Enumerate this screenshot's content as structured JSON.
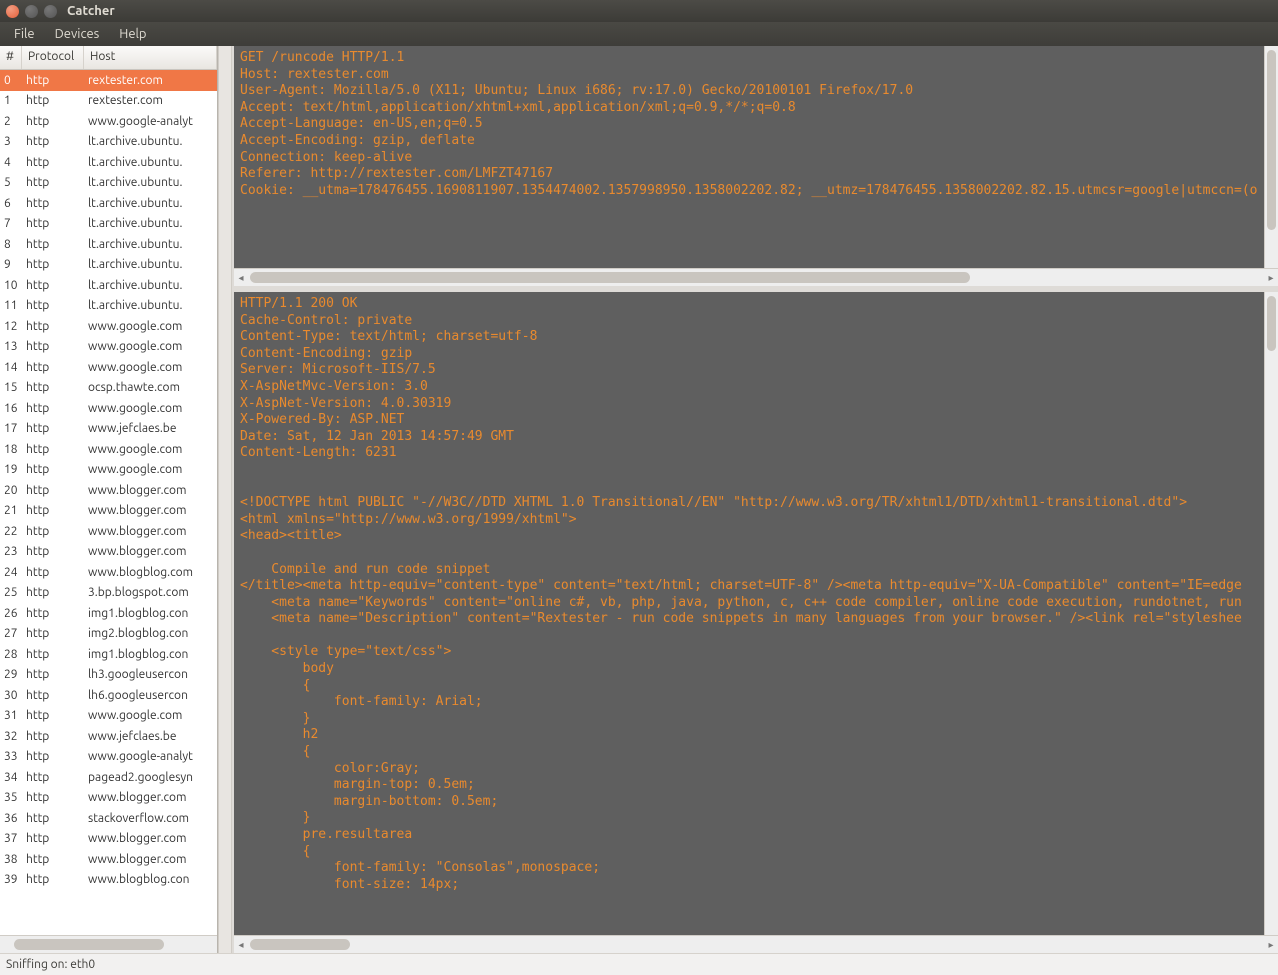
{
  "window": {
    "title": "Catcher"
  },
  "menu": {
    "file": "File",
    "devices": "Devices",
    "help": "Help"
  },
  "table": {
    "headers": {
      "num": "#",
      "protocol": "Protocol",
      "host": "Host"
    },
    "selected_index": 0,
    "rows": [
      {
        "num": "0",
        "protocol": "http",
        "host": "rextester.com"
      },
      {
        "num": "1",
        "protocol": "http",
        "host": "rextester.com"
      },
      {
        "num": "2",
        "protocol": "http",
        "host": "www.google-analyt"
      },
      {
        "num": "3",
        "protocol": "http",
        "host": "lt.archive.ubuntu."
      },
      {
        "num": "4",
        "protocol": "http",
        "host": "lt.archive.ubuntu."
      },
      {
        "num": "5",
        "protocol": "http",
        "host": "lt.archive.ubuntu."
      },
      {
        "num": "6",
        "protocol": "http",
        "host": "lt.archive.ubuntu."
      },
      {
        "num": "7",
        "protocol": "http",
        "host": "lt.archive.ubuntu."
      },
      {
        "num": "8",
        "protocol": "http",
        "host": "lt.archive.ubuntu."
      },
      {
        "num": "9",
        "protocol": "http",
        "host": "lt.archive.ubuntu."
      },
      {
        "num": "10",
        "protocol": "http",
        "host": "lt.archive.ubuntu."
      },
      {
        "num": "11",
        "protocol": "http",
        "host": "lt.archive.ubuntu."
      },
      {
        "num": "12",
        "protocol": "http",
        "host": "www.google.com"
      },
      {
        "num": "13",
        "protocol": "http",
        "host": "www.google.com"
      },
      {
        "num": "14",
        "protocol": "http",
        "host": "www.google.com"
      },
      {
        "num": "15",
        "protocol": "http",
        "host": "ocsp.thawte.com"
      },
      {
        "num": "16",
        "protocol": "http",
        "host": "www.google.com"
      },
      {
        "num": "17",
        "protocol": "http",
        "host": "www.jefclaes.be"
      },
      {
        "num": "18",
        "protocol": "http",
        "host": "www.google.com"
      },
      {
        "num": "19",
        "protocol": "http",
        "host": "www.google.com"
      },
      {
        "num": "20",
        "protocol": "http",
        "host": "www.blogger.com"
      },
      {
        "num": "21",
        "protocol": "http",
        "host": "www.blogger.com"
      },
      {
        "num": "22",
        "protocol": "http",
        "host": "www.blogger.com"
      },
      {
        "num": "23",
        "protocol": "http",
        "host": "www.blogger.com"
      },
      {
        "num": "24",
        "protocol": "http",
        "host": "www.blogblog.com"
      },
      {
        "num": "25",
        "protocol": "http",
        "host": "3.bp.blogspot.com"
      },
      {
        "num": "26",
        "protocol": "http",
        "host": "img1.blogblog.con"
      },
      {
        "num": "27",
        "protocol": "http",
        "host": "img2.blogblog.con"
      },
      {
        "num": "28",
        "protocol": "http",
        "host": "img1.blogblog.con"
      },
      {
        "num": "29",
        "protocol": "http",
        "host": "lh3.googleusercon"
      },
      {
        "num": "30",
        "protocol": "http",
        "host": "lh6.googleusercon"
      },
      {
        "num": "31",
        "protocol": "http",
        "host": "www.google.com"
      },
      {
        "num": "32",
        "protocol": "http",
        "host": "www.jefclaes.be"
      },
      {
        "num": "33",
        "protocol": "http",
        "host": "www.google-analyt"
      },
      {
        "num": "34",
        "protocol": "http",
        "host": "pagead2.googlesyn"
      },
      {
        "num": "35",
        "protocol": "http",
        "host": "www.blogger.com"
      },
      {
        "num": "36",
        "protocol": "http",
        "host": "stackoverflow.com"
      },
      {
        "num": "37",
        "protocol": "http",
        "host": "www.blogger.com"
      },
      {
        "num": "38",
        "protocol": "http",
        "host": "www.blogger.com"
      },
      {
        "num": "39",
        "protocol": "http",
        "host": "www.blogblog.con"
      }
    ]
  },
  "request_text": "GET /runcode HTTP/1.1\nHost: rextester.com\nUser-Agent: Mozilla/5.0 (X11; Ubuntu; Linux i686; rv:17.0) Gecko/20100101 Firefox/17.0\nAccept: text/html,application/xhtml+xml,application/xml;q=0.9,*/*;q=0.8\nAccept-Language: en-US,en;q=0.5\nAccept-Encoding: gzip, deflate\nConnection: keep-alive\nReferer: http://rextester.com/LMFZT47167\nCookie: __utma=178476455.1690811907.1354474002.1357998950.1358002202.82; __utmz=178476455.1358002202.82.15.utmcsr=google|utmccn=(o",
  "response_text": "HTTP/1.1 200 OK\nCache-Control: private\nContent-Type: text/html; charset=utf-8\nContent-Encoding: gzip\nServer: Microsoft-IIS/7.5\nX-AspNetMvc-Version: 3.0\nX-AspNet-Version: 4.0.30319\nX-Powered-By: ASP.NET\nDate: Sat, 12 Jan 2013 14:57:49 GMT\nContent-Length: 6231\n\n\n<!DOCTYPE html PUBLIC \"-//W3C//DTD XHTML 1.0 Transitional//EN\" \"http://www.w3.org/TR/xhtml1/DTD/xhtml1-transitional.dtd\">\n<html xmlns=\"http://www.w3.org/1999/xhtml\">\n<head><title>\n\n    Compile and run code snippet\n</title><meta http-equiv=\"content-type\" content=\"text/html; charset=UTF-8\" /><meta http-equiv=\"X-UA-Compatible\" content=\"IE=edge\n    <meta name=\"Keywords\" content=\"online c#, vb, php, java, python, c, c++ code compiler, online code execution, rundotnet, run\n    <meta name=\"Description\" content=\"Rextester - run code snippets in many languages from your browser.\" /><link rel=\"styleshee\n\n    <style type=\"text/css\">\n        body\n        {\n            font-family: Arial;\n        }\n        h2\n        {\n            color:Gray;\n            margin-top: 0.5em;\n            margin-bottom: 0.5em;\n        }\n        pre.resultarea\n        {\n            font-family: \"Consolas\",monospace;\n            font-size: 14px;",
  "status": {
    "text": "Sniffing on: eth0"
  }
}
